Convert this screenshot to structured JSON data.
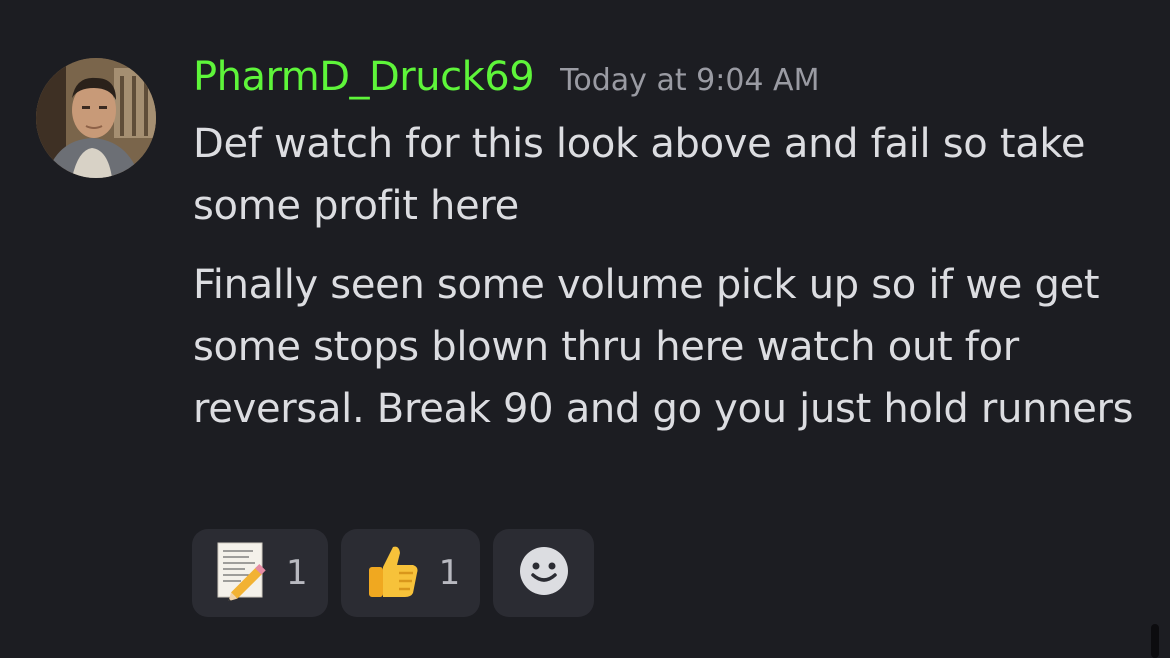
{
  "message": {
    "username": "PharmD_Druck69",
    "timestamp": "Today at 9:04 AM",
    "paragraphs": [
      "Def watch for this look above and fail so take some profit here",
      "Finally seen some volume pick up so if we get some stops blown thru here watch out for reversal. Break 90 and go you just hold runners"
    ],
    "username_color": "#5ef53a"
  },
  "reactions": [
    {
      "icon": "memo-emoji",
      "count": "1"
    },
    {
      "icon": "thumbs-up-emoji",
      "count": "1"
    }
  ],
  "add_reaction_icon": "smiley-add-reaction-icon"
}
